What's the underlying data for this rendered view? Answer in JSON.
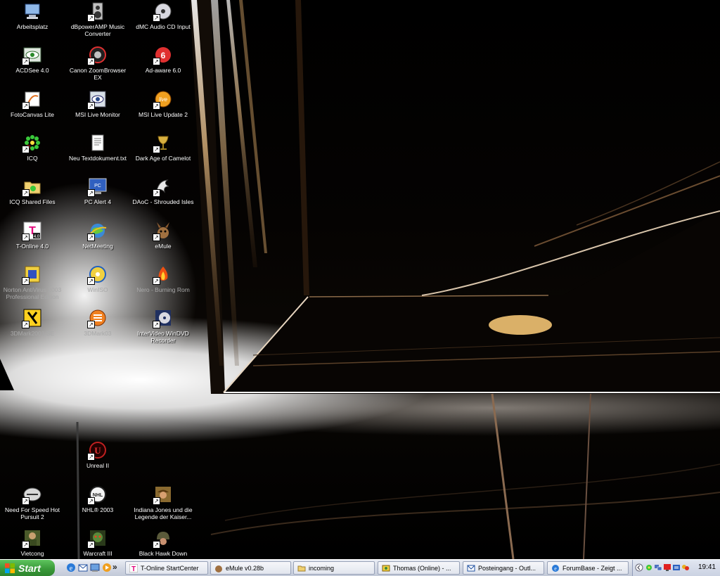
{
  "desktop": {
    "icons": [
      {
        "label": "Arbeitsplatz",
        "icon": "computer-icon"
      },
      {
        "label": "dBpowerAMP Music Converter",
        "icon": "speaker-icon"
      },
      {
        "label": "dMC Audio CD Input",
        "icon": "cd-icon"
      },
      {
        "label": "ACDSee 4.0",
        "icon": "eye-icon"
      },
      {
        "label": "Canon ZoomBrowser EX",
        "icon": "camera-icon"
      },
      {
        "label": "Ad-aware 6.0",
        "icon": "adaware-icon"
      },
      {
        "label": "FotoCanvas Lite",
        "icon": "canvas-icon"
      },
      {
        "label": "MSI Live Monitor",
        "icon": "monitor-icon"
      },
      {
        "label": "MSI Live Update 2",
        "icon": "live-update-icon"
      },
      {
        "label": "ICQ",
        "icon": "flower-icon"
      },
      {
        "label": "Neu Textdokument.txt",
        "icon": "text-document-icon"
      },
      {
        "label": "Dark Age of Camelot",
        "icon": "chalice-icon"
      },
      {
        "label": "ICQ Shared Files",
        "icon": "folder-flower-icon"
      },
      {
        "label": "PC Alert 4",
        "icon": "alert-monitor-icon"
      },
      {
        "label": "DAoC - Shrouded Isles",
        "icon": "dragon-icon"
      },
      {
        "label": "T-Online 4.0",
        "icon": "t-online-icon"
      },
      {
        "label": "NetMeeting",
        "icon": "globe-icon"
      },
      {
        "label": "eMule",
        "icon": "mule-icon"
      },
      {
        "label": "Norton AntiVirus 2003 Professional Edition",
        "icon": "norton-icon"
      },
      {
        "label": "WinISO",
        "icon": "disc-globe-icon"
      },
      {
        "label": "Nero - Burning Rom",
        "icon": "fire-icon"
      },
      {
        "label": "3DMark2001 SE",
        "icon": "3dmark-icon"
      },
      {
        "label": "3DMark03",
        "icon": "3dmark03-icon"
      },
      {
        "label": "InterVideo WinDVD Recorder",
        "icon": "dvd-icon"
      },
      {
        "label": "Unreal II",
        "icon": "unreal-icon"
      },
      {
        "label": "Need For Speed Hot Pursuit 2",
        "icon": "nfs-icon"
      },
      {
        "label": "NHL® 2003",
        "icon": "hockey-icon"
      },
      {
        "label": "Indiana Jones und die Legende der Kaiser...",
        "icon": "indiana-icon"
      },
      {
        "label": "Vietcong",
        "icon": "soldier-icon"
      },
      {
        "label": "Warcraft III",
        "icon": "orc-icon"
      },
      {
        "label": "Black Hawk Down",
        "icon": "helmet-icon"
      }
    ]
  },
  "taskbar": {
    "start_label": "Start",
    "quick_launch": [
      "internet-explorer-icon",
      "outlook-icon",
      "show-desktop-icon",
      "media-player-icon"
    ],
    "overflow_label": "»",
    "tasks": [
      {
        "label": "T-Online StartCenter",
        "icon": "t-online-icon"
      },
      {
        "label": "eMule v0.28b",
        "icon": "mule-icon"
      },
      {
        "label": "incoming",
        "icon": "folder-icon"
      },
      {
        "label": "Thomas (Online) - ...",
        "icon": "messenger-icon"
      },
      {
        "label": "Posteingang - Outl...",
        "icon": "outlook-icon"
      },
      {
        "label": "ForumBase - Zeigt ...",
        "icon": "internet-explorer-icon"
      }
    ],
    "tray_icons": [
      "expand-tray-icon",
      "icq-tray-icon",
      "network-tray-icon",
      "monitor-tray-icon",
      "volume-tray-icon",
      "messenger-tray-icon"
    ],
    "clock": "19:41"
  }
}
